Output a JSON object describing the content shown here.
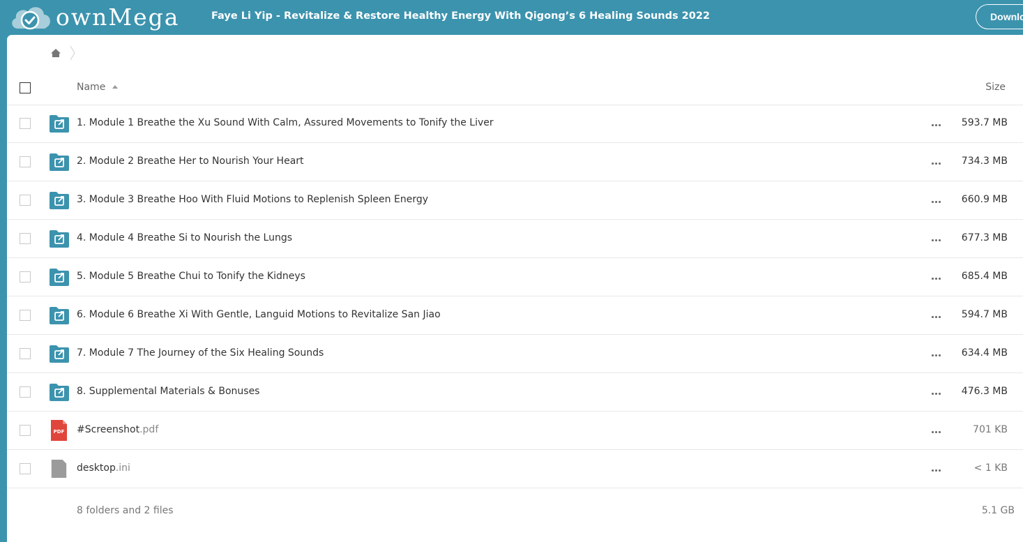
{
  "header": {
    "logo_text": "ownMega",
    "title": "Faye Li Yip - Revitalize & Restore Healthy Energy With Qigong’s 6 Healing Sounds 2022",
    "download_label": "Download"
  },
  "colors": {
    "brand": "#3c93ae",
    "folder_icon": "#3c93ae",
    "pdf_icon": "#e0453b",
    "generic_file_icon": "#9b9b9b"
  },
  "table": {
    "col_name": "Name",
    "col_size": "Size",
    "rows": [
      {
        "name": "1. Module 1 Breathe the Xu Sound With Calm, Assured Movements to Tonify the Liver",
        "ext": "",
        "size": "593.7 MB",
        "icon": "shared-folder-icon"
      },
      {
        "name": "2. Module 2 Breathe Her to Nourish Your Heart",
        "ext": "",
        "size": "734.3 MB",
        "icon": "shared-folder-icon"
      },
      {
        "name": "3. Module 3 Breathe Hoo With Fluid Motions to Replenish Spleen Energy",
        "ext": "",
        "size": "660.9 MB",
        "icon": "shared-folder-icon"
      },
      {
        "name": "4. Module 4 Breathe Si to Nourish the Lungs",
        "ext": "",
        "size": "677.3 MB",
        "icon": "shared-folder-icon"
      },
      {
        "name": "5. Module 5 Breathe Chui to Tonify the Kidneys",
        "ext": "",
        "size": "685.4 MB",
        "icon": "shared-folder-icon"
      },
      {
        "name": "6. Module 6 Breathe Xi With Gentle, Languid Motions to Revitalize San Jiao",
        "ext": "",
        "size": "594.7 MB",
        "icon": "shared-folder-icon"
      },
      {
        "name": "7. Module 7 The Journey of the Six Healing Sounds",
        "ext": "",
        "size": "634.4 MB",
        "icon": "shared-folder-icon"
      },
      {
        "name": "8. Supplemental Materials & Bonuses",
        "ext": "",
        "size": "476.3 MB",
        "icon": "shared-folder-icon"
      },
      {
        "name": "#Screenshot",
        "ext": ".pdf",
        "size": "701 KB",
        "icon": "pdf-file-icon",
        "badge": "PDF"
      },
      {
        "name": "desktop",
        "ext": ".ini",
        "size": "< 1 KB",
        "icon": "generic-file-icon"
      }
    ]
  },
  "summary": {
    "text": "8 folders and 2 files",
    "total_size": "5.1 GB"
  }
}
